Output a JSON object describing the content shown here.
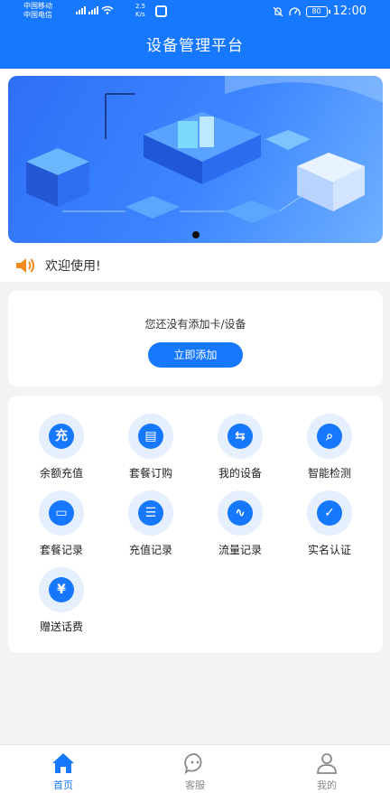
{
  "status": {
    "carrier1": "中国移动",
    "carrier2": "中国电信",
    "net_speed": "2.5",
    "net_unit": "K/s",
    "battery": "80",
    "time": "12:00"
  },
  "header": {
    "title": "设备管理平台"
  },
  "notice": {
    "text": "欢迎使用!"
  },
  "empty": {
    "text": "您还没有添加卡/设备",
    "button": "立即添加"
  },
  "grid": [
    {
      "label": "余额充值",
      "glyph": "充",
      "icon": "recharge-icon"
    },
    {
      "label": "套餐订购",
      "glyph": "▤",
      "icon": "package-order-icon"
    },
    {
      "label": "我的设备",
      "glyph": "⇆",
      "icon": "my-device-icon"
    },
    {
      "label": "智能检测",
      "glyph": "⌕",
      "icon": "smart-detect-icon"
    },
    {
      "label": "套餐记录",
      "glyph": "▭",
      "icon": "package-record-icon"
    },
    {
      "label": "充值记录",
      "glyph": "☰",
      "icon": "recharge-record-icon"
    },
    {
      "label": "流量记录",
      "glyph": "∿",
      "icon": "traffic-record-icon"
    },
    {
      "label": "实名认证",
      "glyph": "✓",
      "icon": "real-name-icon"
    },
    {
      "label": "赠送话费",
      "glyph": "¥",
      "icon": "gift-credit-icon"
    }
  ],
  "tabs": [
    {
      "label": "首页",
      "active": true
    },
    {
      "label": "客服",
      "active": false
    },
    {
      "label": "我的",
      "active": false
    }
  ],
  "colors": {
    "primary": "#1677ff",
    "icon_bg": "#e6effd",
    "page_bg": "#f3f3f3"
  }
}
